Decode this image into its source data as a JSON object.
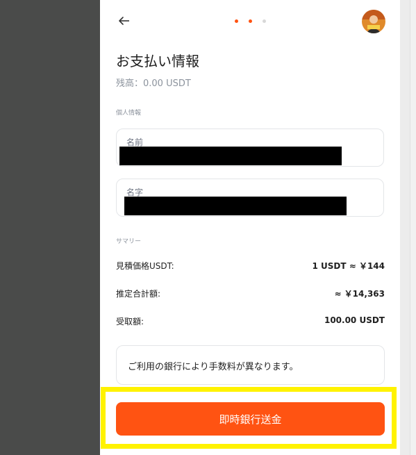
{
  "colors": {
    "accent": "#ff5312",
    "highlight": "#fff200",
    "step_active": "#ff5312",
    "step_inactive": "#d8d8d8"
  },
  "header": {
    "back_icon": "back-arrow-icon",
    "steps_total": 3,
    "steps_active": 2,
    "avatar_icon": "user-avatar"
  },
  "page": {
    "title": "お支払い情報",
    "balance": "残高：0.00 USDT"
  },
  "personal_info": {
    "section_label": "個人情報",
    "first_name": {
      "label": "名前",
      "value": "████████████████████"
    },
    "last_name": {
      "label": "名字",
      "value": "████████████████████"
    }
  },
  "summary": {
    "section_label": "サマリー",
    "rows": [
      {
        "key": "見積価格USDT:",
        "value": "1 USDT ≈ ￥144"
      },
      {
        "key": "推定合計額:",
        "value": "≈ ￥14,363"
      },
      {
        "key": "受取額:",
        "value": "100.00 USDT"
      }
    ]
  },
  "notice": {
    "text": "ご利用の銀行により手数料が異なります。"
  },
  "cta": {
    "label": "即時銀行送金"
  }
}
